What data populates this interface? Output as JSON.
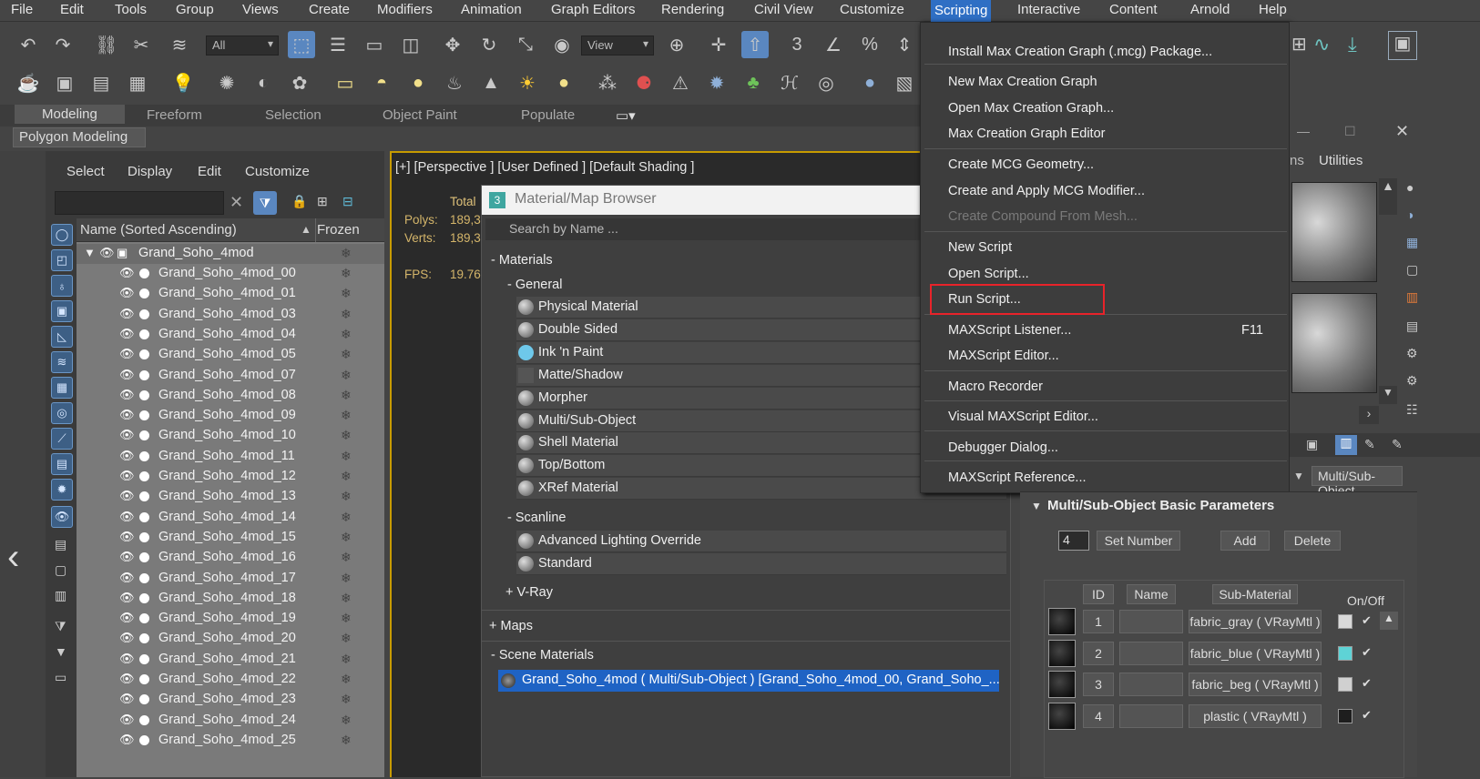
{
  "menubar": {
    "items": [
      "File",
      "Edit",
      "Tools",
      "Group",
      "Views",
      "Create",
      "Modifiers",
      "Animation",
      "Graph Editors",
      "Rendering",
      "Civil View",
      "Customize",
      "Scripting",
      "Interactive",
      "Content",
      "Arnold",
      "Help"
    ]
  },
  "toolbar": {
    "filter": "All",
    "view": "View"
  },
  "ribbon": {
    "tabs": [
      "Modeling",
      "Freeform",
      "Selection",
      "Object Paint",
      "Populate"
    ],
    "panel": "Polygon Modeling"
  },
  "explorer": {
    "menu": [
      "Select",
      "Display",
      "Edit",
      "Customize"
    ],
    "col_name": "Name (Sorted Ascending)",
    "col_frozen": "Frozen",
    "root": "Grand_Soho_4mod",
    "items": [
      "Grand_Soho_4mod_00",
      "Grand_Soho_4mod_01",
      "Grand_Soho_4mod_03",
      "Grand_Soho_4mod_04",
      "Grand_Soho_4mod_05",
      "Grand_Soho_4mod_07",
      "Grand_Soho_4mod_08",
      "Grand_Soho_4mod_09",
      "Grand_Soho_4mod_10",
      "Grand_Soho_4mod_11",
      "Grand_Soho_4mod_12",
      "Grand_Soho_4mod_13",
      "Grand_Soho_4mod_14",
      "Grand_Soho_4mod_15",
      "Grand_Soho_4mod_16",
      "Grand_Soho_4mod_17",
      "Grand_Soho_4mod_18",
      "Grand_Soho_4mod_19",
      "Grand_Soho_4mod_20",
      "Grand_Soho_4mod_21",
      "Grand_Soho_4mod_22",
      "Grand_Soho_4mod_23",
      "Grand_Soho_4mod_24",
      "Grand_Soho_4mod_25"
    ]
  },
  "viewport": {
    "title": "[+] [Perspective ] [User Defined ] [Default Shading ]",
    "total": "Total",
    "polys_label": "Polys:",
    "polys": "189,3",
    "verts_label": "Verts:",
    "verts": "189,3",
    "fps_label": "FPS:",
    "fps": "19.76"
  },
  "browser": {
    "title": "Material/Map Browser",
    "search": "Search by Name ...",
    "materials": "- Materials",
    "general": "- General",
    "general_items": [
      "Physical Material",
      "Double Sided",
      "Ink 'n Paint",
      "Matte/Shadow",
      "Morpher",
      "Multi/Sub-Object",
      "Shell Material",
      "Top/Bottom",
      "XRef Material"
    ],
    "scanline": "- Scanline",
    "scanline_items": [
      "Advanced Lighting Override",
      "Standard"
    ],
    "vray": "+ V-Ray",
    "maps": "+ Maps",
    "scene": "- Scene Materials",
    "scene_item": "Grand_Soho_4mod ( Multi/Sub-Object ) [Grand_Soho_4mod_00, Grand_Soho_..."
  },
  "scripting_menu": {
    "items": [
      {
        "label": "Install Max Creation Graph (.mcg) Package..."
      },
      {
        "label": "New Max Creation Graph"
      },
      {
        "label": "Open Max Creation Graph..."
      },
      {
        "label": "Max Creation Graph Editor"
      },
      {
        "label": "Create MCG Geometry..."
      },
      {
        "label": "Create and Apply MCG Modifier..."
      },
      {
        "label": "Create Compound From Mesh...",
        "disabled": true
      },
      {
        "label": "New Script"
      },
      {
        "label": "Open Script..."
      },
      {
        "label": "Run Script..."
      },
      {
        "label": "MAXScript Listener...",
        "shortcut": "F11"
      },
      {
        "label": "MAXScript Editor..."
      },
      {
        "label": "Macro Recorder"
      },
      {
        "label": "Visual MAXScript Editor..."
      },
      {
        "label": "Debugger Dialog..."
      },
      {
        "label": "MAXScript Reference..."
      }
    ]
  },
  "right": {
    "utilities": "Utilities",
    "ns": "ns",
    "mat_type": "Multi/Sub-Object"
  },
  "params": {
    "title": "Multi/Sub-Object Basic Parameters",
    "count": "4",
    "set_number": "Set Number",
    "add": "Add",
    "delete": "Delete",
    "col_id": "ID",
    "col_name": "Name",
    "col_sub": "Sub-Material",
    "col_onoff": "On/Off",
    "rows": [
      {
        "id": "1",
        "sub": "fabric_gray  ( VRayMtl )",
        "color": "#d9d9d9"
      },
      {
        "id": "2",
        "sub": "fabric_blue  ( VRayMtl )",
        "color": "#5ed3d6"
      },
      {
        "id": "3",
        "sub": "fabric_beg  ( VRayMtl )",
        "color": "#d0d0d0"
      },
      {
        "id": "4",
        "sub": "plastic  ( VRayMtl )",
        "color": "#1e1e1e"
      }
    ]
  }
}
